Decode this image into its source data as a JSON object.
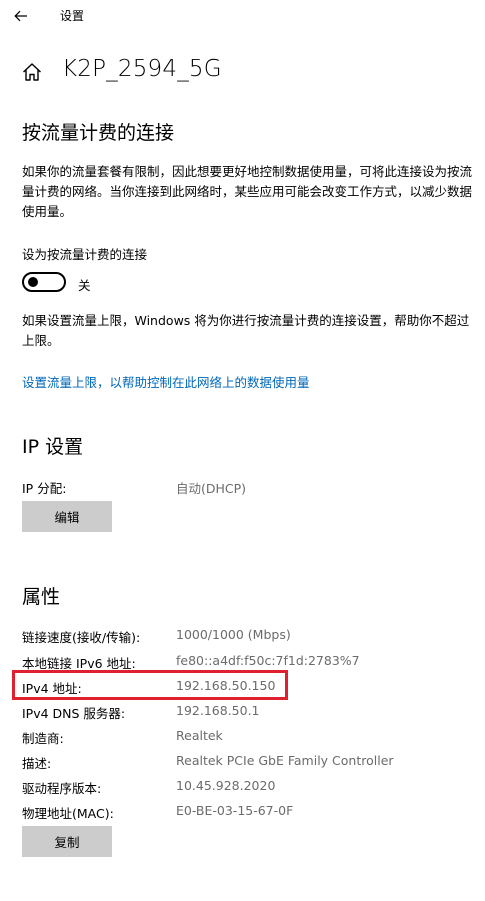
{
  "titlebar": {
    "back_icon": "back-arrow-icon",
    "title": "设置"
  },
  "network": {
    "icon": "home-icon",
    "name": "K2P_2594_5G"
  },
  "metered": {
    "heading": "按流量计费的连接",
    "description": "如果你的流量套餐有限制，因此想要更好地控制数据使用量，可将此连接设为按流量计费的网络。当你连接到此网络时，某些应用可能会改变工作方式，以减少数据使用量。",
    "toggle_label": "设为按流量计费的连接",
    "toggle_state": "关",
    "toggle_on": false,
    "limit_description": "如果设置流量上限，Windows 将为你进行按流量计费的连接设置，帮助你不超过上限。",
    "limit_link": "设置流量上限，以帮助控制在此网络上的数据使用量"
  },
  "ip_settings": {
    "heading": "IP 设置",
    "assignment_label": "IP 分配:",
    "assignment_value": "自动(DHCP)",
    "edit_button": "编辑"
  },
  "properties": {
    "heading": "属性",
    "rows": [
      {
        "label": "链接速度(接收/传输):",
        "value": "1000/1000 (Mbps)"
      },
      {
        "label": "本地链接 IPv6 地址:",
        "value": "fe80::a4df:f50c:7f1d:2783%7"
      },
      {
        "label": "IPv4 地址:",
        "value": "192.168.50.150"
      },
      {
        "label": "IPv4 DNS 服务器:",
        "value": "192.168.50.1"
      },
      {
        "label": "制造商:",
        "value": "Realtek"
      },
      {
        "label": "描述:",
        "value": "Realtek PCIe GbE Family Controller"
      },
      {
        "label": "驱动程序版本:",
        "value": "10.45.928.2020"
      },
      {
        "label": "物理地址(MAC):",
        "value": "E0-BE-03-15-67-0F"
      }
    ],
    "copy_button": "复制"
  },
  "colors": {
    "link": "#0067b8",
    "highlight": "#e0202e",
    "button_bg": "#cccccc",
    "value_text": "#6b6b6b"
  }
}
